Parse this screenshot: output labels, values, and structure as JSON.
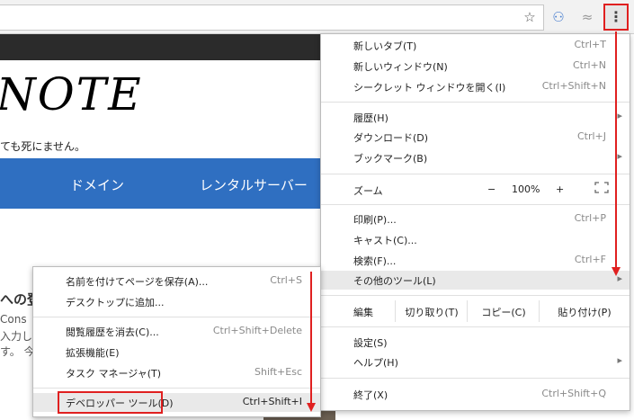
{
  "toolbar": {
    "menu_icon": "⋮"
  },
  "page": {
    "logo": "NOTE",
    "tagline": "ても死にません。",
    "nav": [
      "ドメイン",
      "レンタルサーバー"
    ],
    "heading_fragment": "への登",
    "text_fragments": [
      "Cons",
      "入力し",
      "す。 今"
    ]
  },
  "main_menu": {
    "items": [
      {
        "label": "新しいタブ(T)",
        "shortcut": "Ctrl+T"
      },
      {
        "label": "新しいウィンドウ(N)",
        "shortcut": "Ctrl+N"
      },
      {
        "label": "シークレット ウィンドウを開く(I)",
        "shortcut": "Ctrl+Shift+N"
      },
      {
        "label": "履歴(H)",
        "shortcut": ""
      },
      {
        "label": "ダウンロード(D)",
        "shortcut": "Ctrl+J"
      },
      {
        "label": "ブックマーク(B)",
        "shortcut": ""
      }
    ],
    "zoom": {
      "label": "ズーム",
      "minus": "−",
      "value": "100%",
      "plus": "+"
    },
    "items2": [
      {
        "label": "印刷(P)...",
        "shortcut": "Ctrl+P"
      },
      {
        "label": "キャスト(C)...",
        "shortcut": ""
      },
      {
        "label": "検索(F)...",
        "shortcut": "Ctrl+F"
      },
      {
        "label": "その他のツール(L)",
        "shortcut": ""
      }
    ],
    "edit": {
      "label": "編集",
      "cut": "切り取り(T)",
      "copy": "コピー(C)",
      "paste": "貼り付け(P)"
    },
    "items3": [
      {
        "label": "設定(S)",
        "shortcut": ""
      },
      {
        "label": "ヘルプ(H)",
        "shortcut": ""
      },
      {
        "label": "終了(X)",
        "shortcut": "Ctrl+Shift+Q"
      }
    ],
    "submenu_arrow": "▸"
  },
  "sub_menu": {
    "items": [
      {
        "label": "名前を付けてページを保存(A)...",
        "shortcut": "Ctrl+S"
      },
      {
        "label": "デスクトップに追加...",
        "shortcut": ""
      },
      {
        "label": "閲覧履歴を消去(C)...",
        "shortcut": "Ctrl+Shift+Delete"
      },
      {
        "label": "拡張機能(E)",
        "shortcut": ""
      },
      {
        "label": "タスク マネージャ(T)",
        "shortcut": "Shift+Esc"
      },
      {
        "label": "デベロッパー ツール(D)",
        "shortcut": "Ctrl+Shift+I"
      }
    ]
  },
  "colors": {
    "highlight_red": "#e02020",
    "nav_blue": "#2f6fc1",
    "header_dark": "#2b2b2b"
  }
}
